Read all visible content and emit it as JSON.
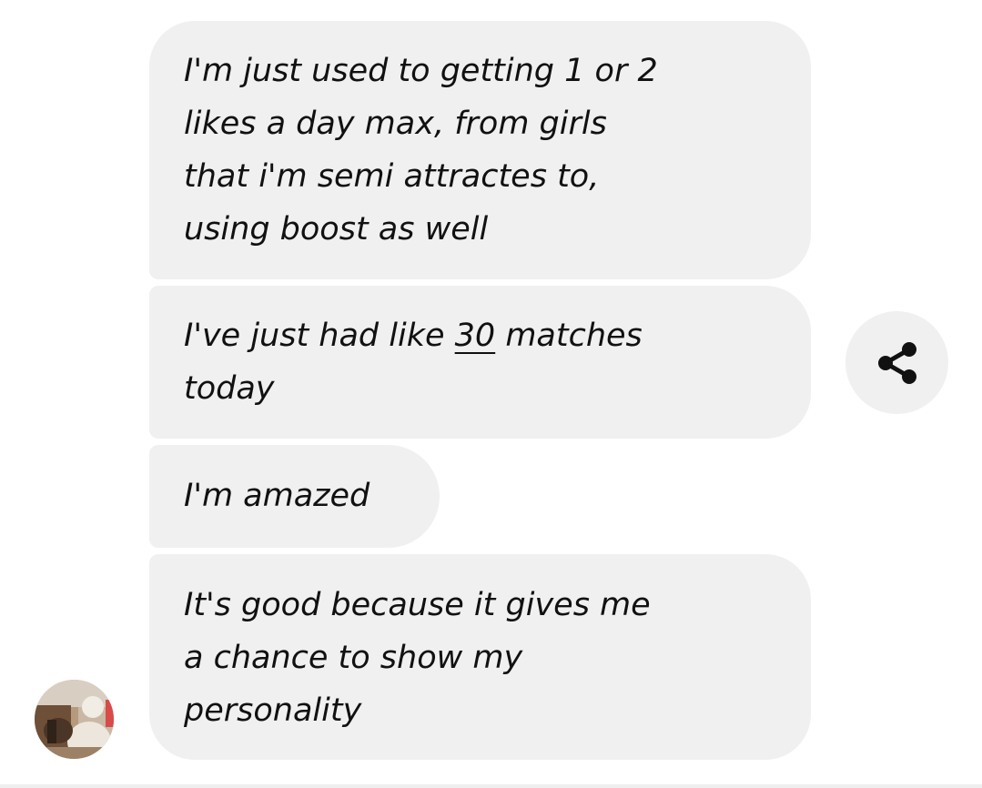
{
  "messages": [
    {
      "text": "I'm just used to getting 1 or 2\nlikes a day max, from girls\nthat i'm semi attractes to,\nusing boost as well"
    },
    {
      "text_before": "I've just had like ",
      "text_link": "30",
      "text_after": " matches\ntoday"
    },
    {
      "text": "I'm amazed"
    },
    {
      "text": "It's good because it gives me\na chance to show my\npersonality"
    }
  ],
  "share": {
    "icon": "share-icon"
  },
  "sender": {
    "avatar": "avatar"
  },
  "colors": {
    "bubble_bg": "#f0f0f0",
    "text": "#111111",
    "background": "#ffffff"
  }
}
